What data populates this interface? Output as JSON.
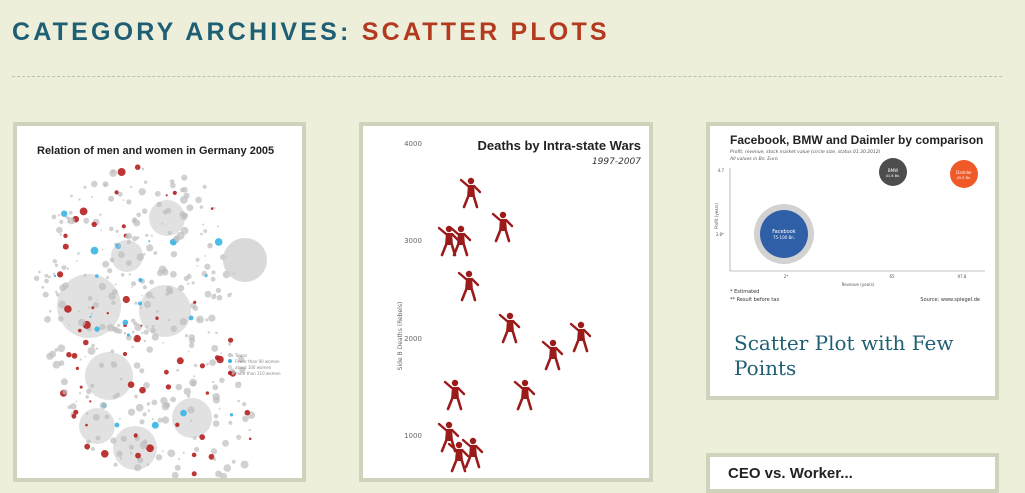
{
  "page": {
    "heading_prefix": "CATEGORY ARCHIVES: ",
    "heading_category": "SCATTER PLOTS",
    "accent_colors": {
      "heading": "#1f5f74",
      "category": "#b3391f",
      "background": "#edefdb",
      "card_border": "#cfd3bb"
    }
  },
  "posts": [
    {
      "thumbnail": {
        "title": "Relation of men and women in Germany 2005",
        "legend": [
          "Towns",
          "Fewer than 90 women",
          "about 100 women",
          "more than 110 women"
        ]
      }
    },
    {
      "thumbnail": {
        "title": "Deaths by Intra-state Wars",
        "subtitle": "1997-2007",
        "ylabel": "Side B Deaths (Rebels)",
        "yticks": [
          "4000",
          "3000",
          "2000",
          "1000"
        ]
      }
    },
    {
      "title": "Scatter Plot with Few Points",
      "thumbnail": {
        "title": "Facebook, BMW and Daimler by comparison",
        "subtitle": "Profit, revenue, stock market value (circle size, status 01.30.2012)",
        "subtitle2": "All values in Bn. Euro",
        "bubbles": [
          {
            "name": "Facebook",
            "value": "75-100 Bn.",
            "color": "#2f5fa7"
          },
          {
            "name": "BMW",
            "value": "41.6 Bn.",
            "color": "#4d4d4d"
          },
          {
            "name": "Daimler",
            "value": "45.5 Bn.",
            "color": "#f05a28"
          }
        ],
        "ylabel": "Profit (years)",
        "xlabel": "Revenue (years)",
        "xticks": [
          "2*",
          "65",
          "97.8"
        ],
        "yticks": [
          "4.7",
          "3.8*"
        ],
        "footnote1": "* Estimated",
        "footnote2": "** Result before tax",
        "source": "Source: www.spiegel.de"
      }
    },
    {
      "title": "CEO vs. Worker..."
    }
  ]
}
